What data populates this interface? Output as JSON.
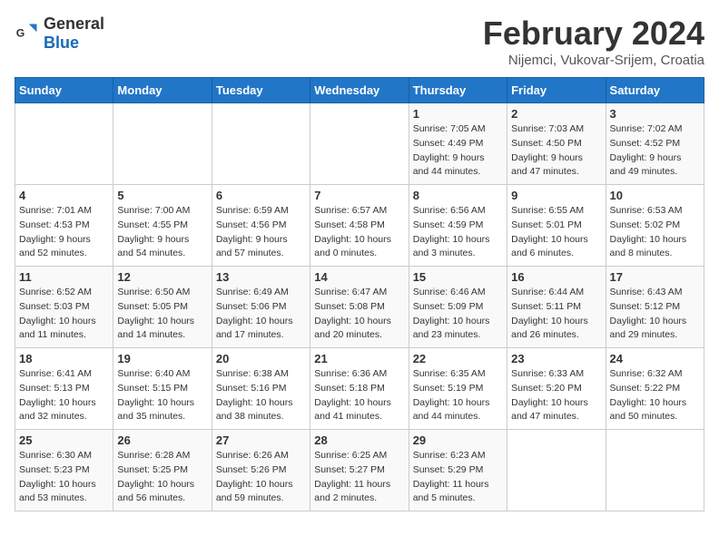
{
  "logo": {
    "general": "General",
    "blue": "Blue"
  },
  "header": {
    "month_year": "February 2024",
    "location": "Nijemci, Vukovar-Srijem, Croatia"
  },
  "days_of_week": [
    "Sunday",
    "Monday",
    "Tuesday",
    "Wednesday",
    "Thursday",
    "Friday",
    "Saturday"
  ],
  "weeks": [
    [
      {
        "day": "",
        "info": ""
      },
      {
        "day": "",
        "info": ""
      },
      {
        "day": "",
        "info": ""
      },
      {
        "day": "",
        "info": ""
      },
      {
        "day": "1",
        "info": "Sunrise: 7:05 AM\nSunset: 4:49 PM\nDaylight: 9 hours\nand 44 minutes."
      },
      {
        "day": "2",
        "info": "Sunrise: 7:03 AM\nSunset: 4:50 PM\nDaylight: 9 hours\nand 47 minutes."
      },
      {
        "day": "3",
        "info": "Sunrise: 7:02 AM\nSunset: 4:52 PM\nDaylight: 9 hours\nand 49 minutes."
      }
    ],
    [
      {
        "day": "4",
        "info": "Sunrise: 7:01 AM\nSunset: 4:53 PM\nDaylight: 9 hours\nand 52 minutes."
      },
      {
        "day": "5",
        "info": "Sunrise: 7:00 AM\nSunset: 4:55 PM\nDaylight: 9 hours\nand 54 minutes."
      },
      {
        "day": "6",
        "info": "Sunrise: 6:59 AM\nSunset: 4:56 PM\nDaylight: 9 hours\nand 57 minutes."
      },
      {
        "day": "7",
        "info": "Sunrise: 6:57 AM\nSunset: 4:58 PM\nDaylight: 10 hours\nand 0 minutes."
      },
      {
        "day": "8",
        "info": "Sunrise: 6:56 AM\nSunset: 4:59 PM\nDaylight: 10 hours\nand 3 minutes."
      },
      {
        "day": "9",
        "info": "Sunrise: 6:55 AM\nSunset: 5:01 PM\nDaylight: 10 hours\nand 6 minutes."
      },
      {
        "day": "10",
        "info": "Sunrise: 6:53 AM\nSunset: 5:02 PM\nDaylight: 10 hours\nand 8 minutes."
      }
    ],
    [
      {
        "day": "11",
        "info": "Sunrise: 6:52 AM\nSunset: 5:03 PM\nDaylight: 10 hours\nand 11 minutes."
      },
      {
        "day": "12",
        "info": "Sunrise: 6:50 AM\nSunset: 5:05 PM\nDaylight: 10 hours\nand 14 minutes."
      },
      {
        "day": "13",
        "info": "Sunrise: 6:49 AM\nSunset: 5:06 PM\nDaylight: 10 hours\nand 17 minutes."
      },
      {
        "day": "14",
        "info": "Sunrise: 6:47 AM\nSunset: 5:08 PM\nDaylight: 10 hours\nand 20 minutes."
      },
      {
        "day": "15",
        "info": "Sunrise: 6:46 AM\nSunset: 5:09 PM\nDaylight: 10 hours\nand 23 minutes."
      },
      {
        "day": "16",
        "info": "Sunrise: 6:44 AM\nSunset: 5:11 PM\nDaylight: 10 hours\nand 26 minutes."
      },
      {
        "day": "17",
        "info": "Sunrise: 6:43 AM\nSunset: 5:12 PM\nDaylight: 10 hours\nand 29 minutes."
      }
    ],
    [
      {
        "day": "18",
        "info": "Sunrise: 6:41 AM\nSunset: 5:13 PM\nDaylight: 10 hours\nand 32 minutes."
      },
      {
        "day": "19",
        "info": "Sunrise: 6:40 AM\nSunset: 5:15 PM\nDaylight: 10 hours\nand 35 minutes."
      },
      {
        "day": "20",
        "info": "Sunrise: 6:38 AM\nSunset: 5:16 PM\nDaylight: 10 hours\nand 38 minutes."
      },
      {
        "day": "21",
        "info": "Sunrise: 6:36 AM\nSunset: 5:18 PM\nDaylight: 10 hours\nand 41 minutes."
      },
      {
        "day": "22",
        "info": "Sunrise: 6:35 AM\nSunset: 5:19 PM\nDaylight: 10 hours\nand 44 minutes."
      },
      {
        "day": "23",
        "info": "Sunrise: 6:33 AM\nSunset: 5:20 PM\nDaylight: 10 hours\nand 47 minutes."
      },
      {
        "day": "24",
        "info": "Sunrise: 6:32 AM\nSunset: 5:22 PM\nDaylight: 10 hours\nand 50 minutes."
      }
    ],
    [
      {
        "day": "25",
        "info": "Sunrise: 6:30 AM\nSunset: 5:23 PM\nDaylight: 10 hours\nand 53 minutes."
      },
      {
        "day": "26",
        "info": "Sunrise: 6:28 AM\nSunset: 5:25 PM\nDaylight: 10 hours\nand 56 minutes."
      },
      {
        "day": "27",
        "info": "Sunrise: 6:26 AM\nSunset: 5:26 PM\nDaylight: 10 hours\nand 59 minutes."
      },
      {
        "day": "28",
        "info": "Sunrise: 6:25 AM\nSunset: 5:27 PM\nDaylight: 11 hours\nand 2 minutes."
      },
      {
        "day": "29",
        "info": "Sunrise: 6:23 AM\nSunset: 5:29 PM\nDaylight: 11 hours\nand 5 minutes."
      },
      {
        "day": "",
        "info": ""
      },
      {
        "day": "",
        "info": ""
      }
    ]
  ]
}
